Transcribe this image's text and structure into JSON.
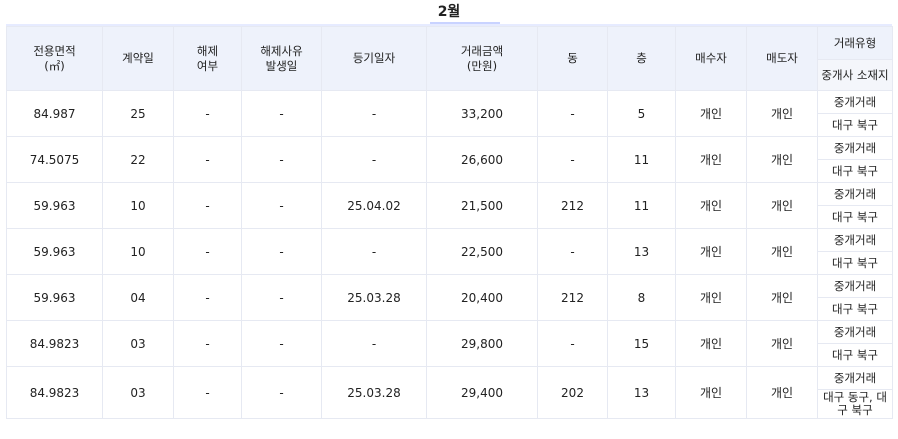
{
  "month": "2월",
  "headers": {
    "area": "전용면적\n(㎡)",
    "day": "계약일",
    "cancel": "해제\n여부",
    "cancel_reason_date": "해제사유\n발생일",
    "reg_date": "등기일자",
    "price": "거래금액\n(만원)",
    "dong": "동",
    "floor": "층",
    "buyer": "매수자",
    "seller": "매도자",
    "deal_type": "거래유형",
    "agent_loc": "중개사 소재지"
  },
  "rows": [
    {
      "area": "84.987",
      "day": "25",
      "cancel": "-",
      "cancel_reason_date": "-",
      "reg_date": "-",
      "price": "33,200",
      "dong": "-",
      "floor": "5",
      "buyer": "개인",
      "seller": "개인",
      "deal_type": "중개거래",
      "agent_loc": "대구 북구"
    },
    {
      "area": "74.5075",
      "day": "22",
      "cancel": "-",
      "cancel_reason_date": "-",
      "reg_date": "-",
      "price": "26,600",
      "dong": "-",
      "floor": "11",
      "buyer": "개인",
      "seller": "개인",
      "deal_type": "중개거래",
      "agent_loc": "대구 북구"
    },
    {
      "area": "59.963",
      "day": "10",
      "cancel": "-",
      "cancel_reason_date": "-",
      "reg_date": "25.04.02",
      "price": "21,500",
      "dong": "212",
      "floor": "11",
      "buyer": "개인",
      "seller": "개인",
      "deal_type": "중개거래",
      "agent_loc": "대구 북구"
    },
    {
      "area": "59.963",
      "day": "10",
      "cancel": "-",
      "cancel_reason_date": "-",
      "reg_date": "-",
      "price": "22,500",
      "dong": "-",
      "floor": "13",
      "buyer": "개인",
      "seller": "개인",
      "deal_type": "중개거래",
      "agent_loc": "대구 북구"
    },
    {
      "area": "59.963",
      "day": "04",
      "cancel": "-",
      "cancel_reason_date": "-",
      "reg_date": "25.03.28",
      "price": "20,400",
      "dong": "212",
      "floor": "8",
      "buyer": "개인",
      "seller": "개인",
      "deal_type": "중개거래",
      "agent_loc": "대구 북구"
    },
    {
      "area": "84.9823",
      "day": "03",
      "cancel": "-",
      "cancel_reason_date": "-",
      "reg_date": "-",
      "price": "29,800",
      "dong": "-",
      "floor": "15",
      "buyer": "개인",
      "seller": "개인",
      "deal_type": "중개거래",
      "agent_loc": "대구 북구"
    },
    {
      "area": "84.9823",
      "day": "03",
      "cancel": "-",
      "cancel_reason_date": "-",
      "reg_date": "25.03.28",
      "price": "29,400",
      "dong": "202",
      "floor": "13",
      "buyer": "개인",
      "seller": "개인",
      "deal_type": "중개거래",
      "agent_loc": "대구 동구, 대구 북구"
    }
  ],
  "colors": {
    "header_bg": "#eef2fb",
    "border": "#e6e9f2",
    "title_underline": "#c9d3ff"
  }
}
